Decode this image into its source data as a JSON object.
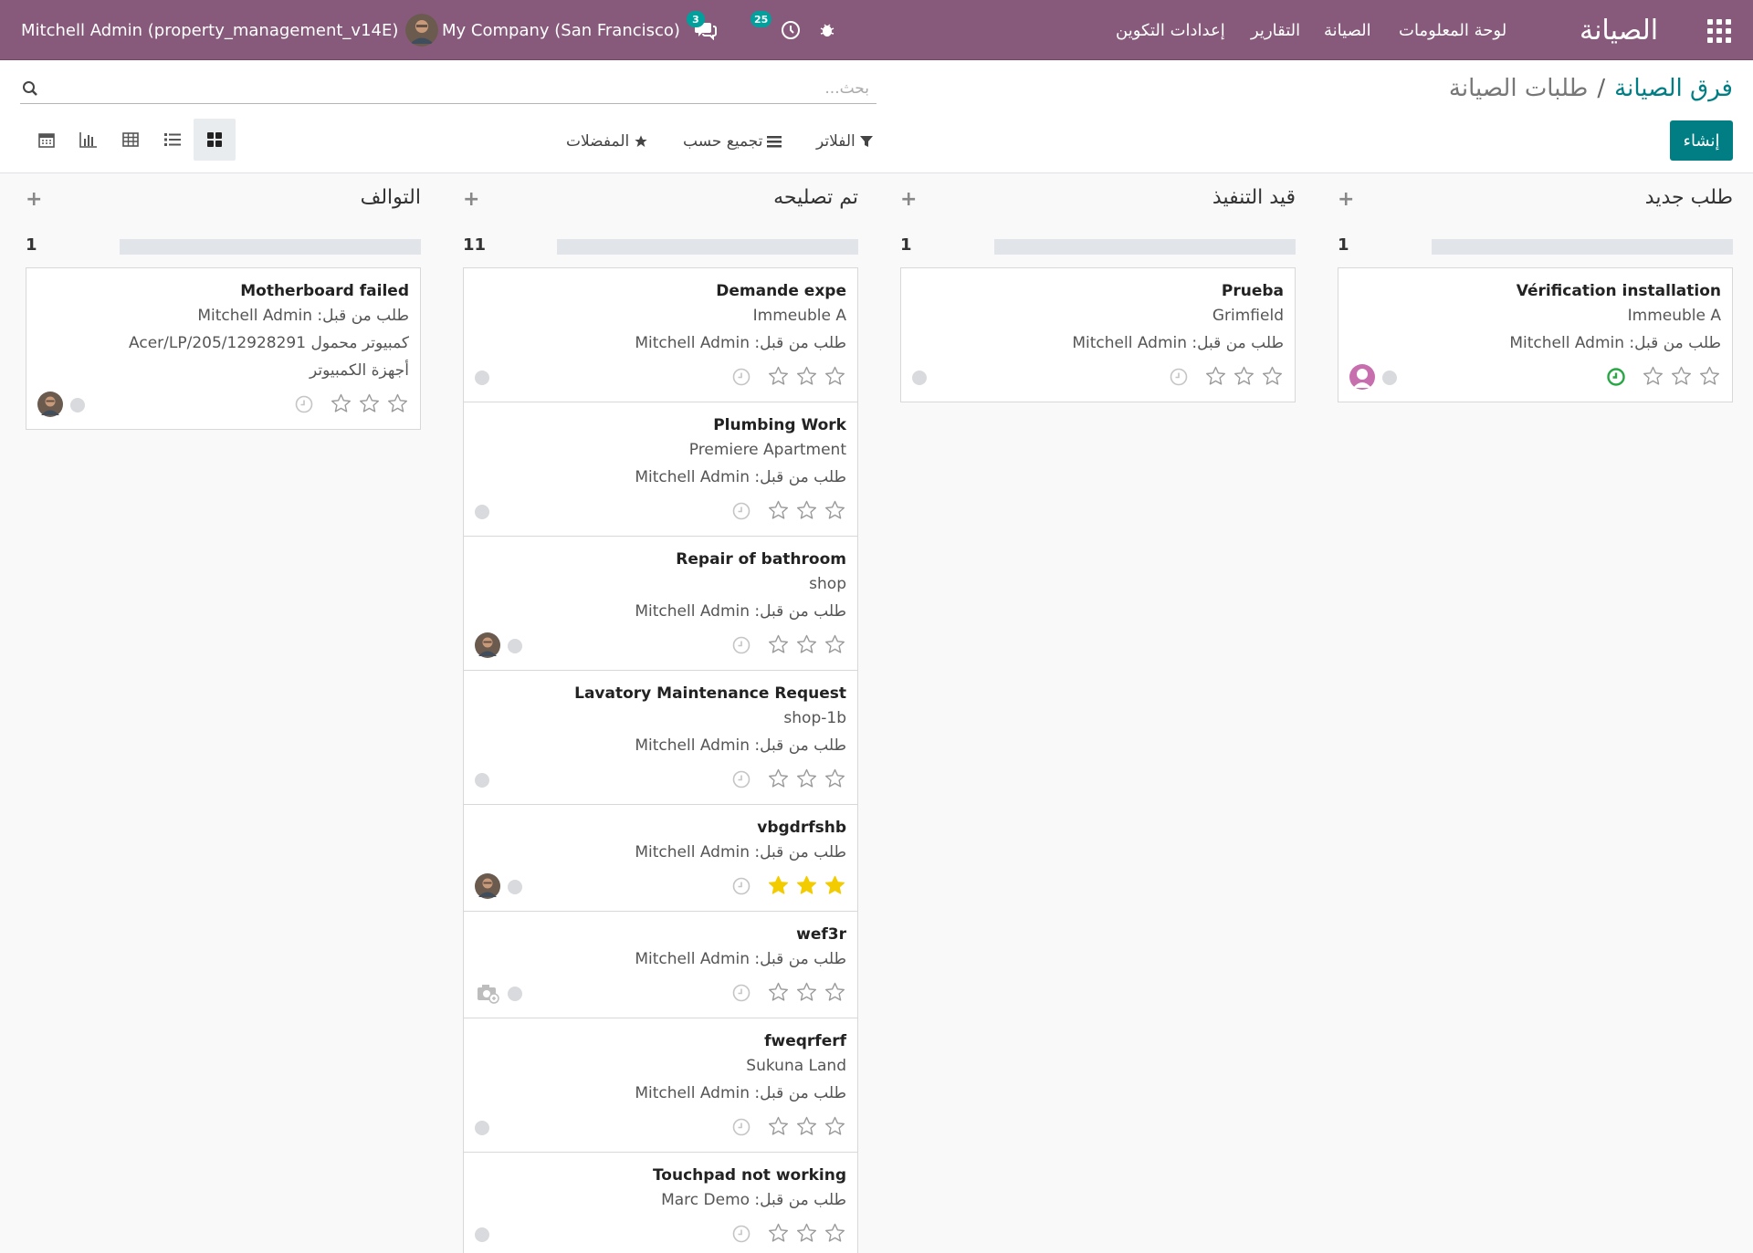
{
  "navbar": {
    "user_label": "Mitchell Admin (property_management_v14E)",
    "company_label": "My Company (San Francisco)",
    "messages_badge": "3",
    "activities_badge": "25",
    "menu": [
      "لوحة المعلومات",
      "الصيانة",
      "التقارير",
      "إعدادات التكوين"
    ],
    "app_title": "الصيانة"
  },
  "control": {
    "breadcrumb_parent": "فرق الصيانة",
    "breadcrumb_separator": "/",
    "breadcrumb_current": "طلبات الصيانة",
    "search_placeholder": "بحث...",
    "create_label": "إنشاء",
    "filters_label": "الفلاتر",
    "groupby_label": "تجميع حسب",
    "favorites_label": "المفضلات"
  },
  "colors": {
    "navbar": "#875a7b",
    "primary": "#017e84",
    "badge": "#00a09d",
    "star_on": "#f3cc00",
    "activity_ok": "#28a745"
  },
  "columns": [
    {
      "title": "طلب جديد",
      "count": "1",
      "progress": 1,
      "cards": [
        {
          "title": "Vérification installation",
          "lines": [
            "Immeuble A",
            "طلب من قبل: Mitchell Admin"
          ],
          "stars": 0,
          "activity": "ok",
          "avatar": "pink-user"
        }
      ]
    },
    {
      "title": "قيد التنفيذ",
      "count": "1",
      "progress": 1,
      "cards": [
        {
          "title": "Prueba",
          "lines": [
            "Grimfield",
            "طلب من قبل: Mitchell Admin"
          ],
          "stars": 0,
          "activity": "none",
          "avatar": ""
        }
      ]
    },
    {
      "title": "تم تصليحه",
      "count": "11",
      "progress": 1,
      "cards": [
        {
          "title": "Demande expe",
          "lines": [
            "Immeuble A",
            "طلب من قبل: Mitchell Admin"
          ],
          "stars": 0,
          "activity": "none",
          "avatar": ""
        },
        {
          "title": "Plumbing Work",
          "lines": [
            "Premiere Apartment",
            "طلب من قبل: Mitchell Admin"
          ],
          "stars": 0,
          "activity": "none",
          "avatar": ""
        },
        {
          "title": "Repair of bathroom",
          "lines": [
            "shop",
            "طلب من قبل: Mitchell Admin"
          ],
          "stars": 0,
          "activity": "none",
          "avatar": "photo"
        },
        {
          "title": "Lavatory Maintenance Request",
          "lines": [
            "shop-1b",
            "طلب من قبل: Mitchell Admin"
          ],
          "stars": 0,
          "activity": "none",
          "avatar": ""
        },
        {
          "title": "vbgdrfshb",
          "lines": [
            "طلب من قبل: Mitchell Admin"
          ],
          "stars": 3,
          "activity": "none",
          "avatar": "photo"
        },
        {
          "title": "wef3r",
          "lines": [
            "طلب من قبل: Mitchell Admin"
          ],
          "stars": 0,
          "activity": "none",
          "avatar": "camera"
        },
        {
          "title": "fweqrferf",
          "lines": [
            "Sukuna Land",
            "طلب من قبل: Mitchell Admin"
          ],
          "stars": 0,
          "activity": "none",
          "avatar": ""
        },
        {
          "title": "Touchpad not working",
          "lines": [
            "طلب من قبل: Marc Demo"
          ],
          "stars": 0,
          "activity": "none",
          "avatar": ""
        }
      ]
    },
    {
      "title": "التوالف",
      "count": "1",
      "progress": 1,
      "cards": [
        {
          "title": "Motherboard failed",
          "lines": [
            "طلب من قبل: Mitchell Admin",
            "كمبيوتر محمول Acer/LP/205/12928291",
            "أجهزة الكمبيوتر"
          ],
          "stars": 0,
          "activity": "none",
          "avatar": "photo"
        }
      ]
    }
  ]
}
